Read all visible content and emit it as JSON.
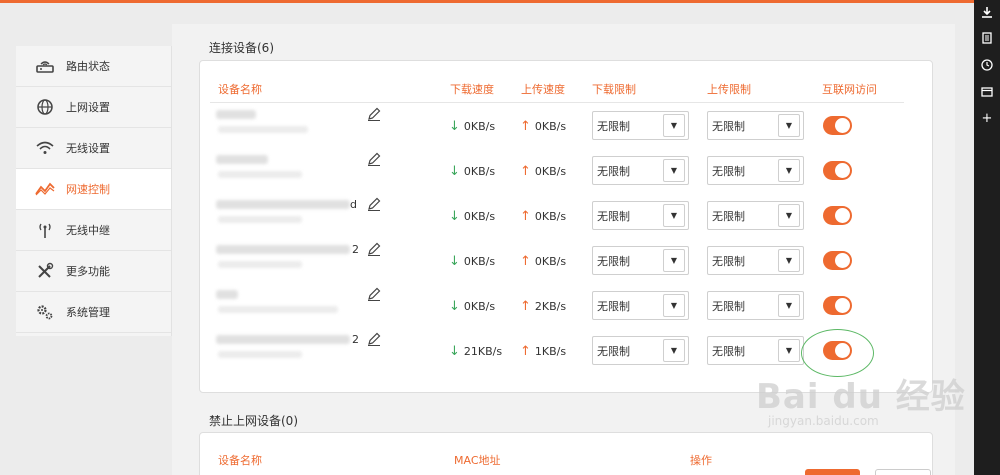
{
  "sidebar": {
    "items": [
      {
        "label": "路由状态",
        "icon": "router-icon",
        "active": false
      },
      {
        "label": "上网设置",
        "icon": "globe-icon",
        "active": false
      },
      {
        "label": "无线设置",
        "icon": "wifi-icon",
        "active": false
      },
      {
        "label": "网速控制",
        "icon": "speed-chart-icon",
        "active": true
      },
      {
        "label": "无线中继",
        "icon": "antenna-icon",
        "active": false
      },
      {
        "label": "更多功能",
        "icon": "tools-icon",
        "active": false
      },
      {
        "label": "系统管理",
        "icon": "gears-icon",
        "active": false
      }
    ]
  },
  "connected": {
    "title": "连接设备(6)",
    "columns": {
      "name": "设备名称",
      "down_speed": "下载速度",
      "up_speed": "上传速度",
      "down_limit": "下载限制",
      "up_limit": "上传限制",
      "internet": "互联网访问"
    },
    "devices": [
      {
        "name_tail": "",
        "down": "0KB/s",
        "up": "0KB/s",
        "down_limit": "无限制",
        "up_limit": "无限制",
        "internet_access": true
      },
      {
        "name_tail": "",
        "down": "0KB/s",
        "up": "0KB/s",
        "down_limit": "无限制",
        "up_limit": "无限制",
        "internet_access": true
      },
      {
        "name_tail": "d",
        "down": "0KB/s",
        "up": "0KB/s",
        "down_limit": "无限制",
        "up_limit": "无限制",
        "internet_access": true
      },
      {
        "name_tail": "2",
        "down": "0KB/s",
        "up": "0KB/s",
        "down_limit": "无限制",
        "up_limit": "无限制",
        "internet_access": true
      },
      {
        "name_tail": "",
        "down": "0KB/s",
        "up": "2KB/s",
        "down_limit": "无限制",
        "up_limit": "无限制",
        "internet_access": true
      },
      {
        "name_tail": "2",
        "down": "21KB/s",
        "up": "1KB/s",
        "down_limit": "无限制",
        "up_limit": "无限制",
        "internet_access": true
      }
    ]
  },
  "blocked": {
    "title": "禁止上网设备(0)",
    "columns": {
      "name": "设备名称",
      "mac": "MAC地址",
      "action": "操作"
    }
  },
  "watermark": {
    "brand": "Bai du 经验",
    "url": "jingyan.baidu.com"
  },
  "rightbar": {
    "icons": [
      "download-icon",
      "document-icon",
      "clock-icon",
      "window-icon",
      "plus-icon"
    ]
  },
  "colors": {
    "accent": "#ee6a30",
    "download_arrow": "#3aa65b",
    "highlight_circle": "#5cb865"
  }
}
